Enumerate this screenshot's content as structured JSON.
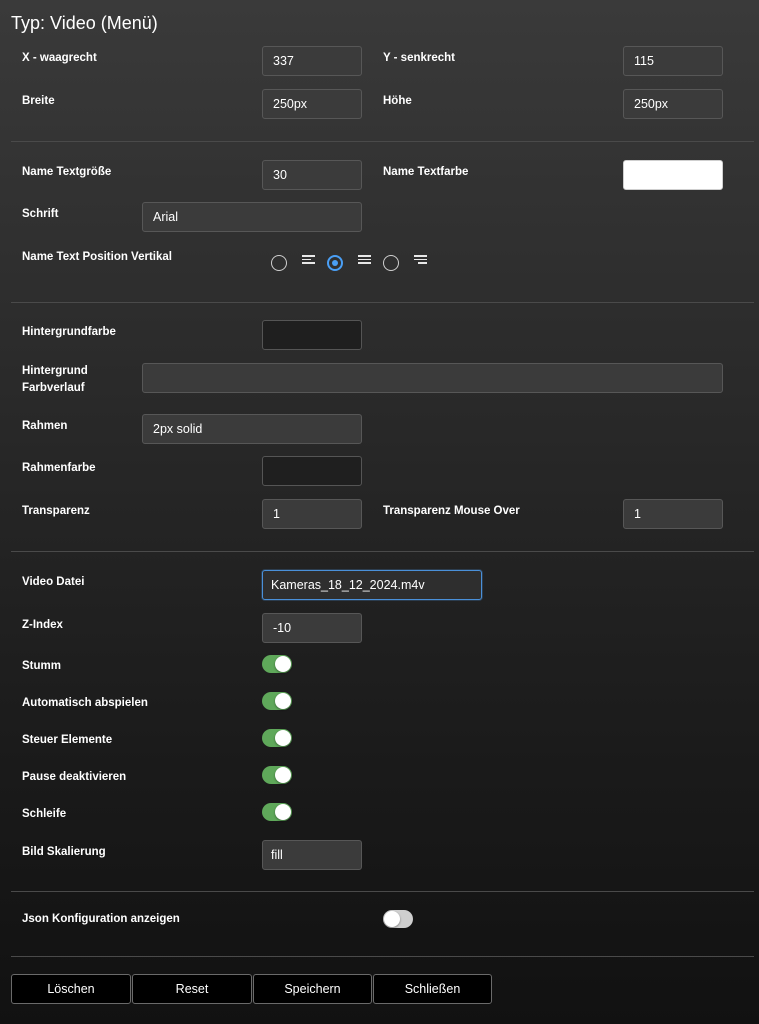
{
  "title": "Typ: Video (Menü)",
  "position": {
    "x_label": "X - waagrecht",
    "x_value": "337",
    "y_label": "Y - senkrecht",
    "y_value": "115",
    "width_label": "Breite",
    "width_value": "250px",
    "height_label": "Höhe",
    "height_value": "250px"
  },
  "text": {
    "size_label": "Name Textgröße",
    "size_value": "30",
    "color_label": "Name Textfarbe",
    "color_value": "#ffffff",
    "font_label": "Schrift",
    "font_value": "Arial",
    "vpos_label": "Name Text Position Vertikal",
    "vpos_options": [
      "top",
      "center",
      "bottom"
    ],
    "vpos_selected": "center"
  },
  "style": {
    "bg_label": "Hintergrundfarbe",
    "bg_value": "",
    "gradient_label_1": "Hintergrund",
    "gradient_label_2": "Farbverlauf",
    "gradient_value": "",
    "border_label": "Rahmen",
    "border_value": "2px solid",
    "border_color_label": "Rahmenfarbe",
    "border_color_value": "",
    "opacity_label": "Transparenz",
    "opacity_value": "1",
    "opacity_hover_label": "Transparenz Mouse Over",
    "opacity_hover_value": "1"
  },
  "video": {
    "file_label": "Video Datei",
    "file_value": "Kameras_18_12_2024.m4v",
    "zindex_label": "Z-Index",
    "zindex_value": "-10",
    "muted_label": "Stumm",
    "muted": true,
    "autoplay_label": "Automatisch abspielen",
    "autoplay": true,
    "controls_label": "Steuer Elemente",
    "controls": true,
    "disable_pause_label": "Pause deaktivieren",
    "disable_pause": true,
    "loop_label": "Schleife",
    "loop": true,
    "scaling_label": "Bild Skalierung",
    "scaling_value": "fill"
  },
  "json": {
    "label": "Json Konfiguration anzeigen",
    "enabled": false
  },
  "buttons": {
    "delete": "Löschen",
    "reset": "Reset",
    "save": "Speichern",
    "close": "Schließen"
  },
  "colors": {
    "accent": "#4a9ff5",
    "toggle_on": "#5fa85a",
    "toggle_off": "#cfcfcf"
  }
}
